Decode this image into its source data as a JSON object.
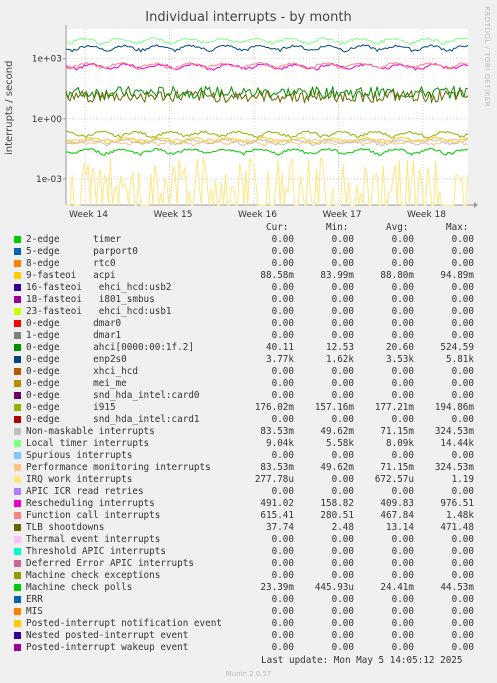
{
  "title": "Individual interrupts - by month",
  "side_label": "RRDTOOL / TOBI OETIKER",
  "footer": {
    "last_update": "Last update: Mon May  5 14:05:12 2025",
    "munin": "Munin 2.0.57"
  },
  "legend_headers": {
    "cur": "Cur:",
    "min": "Min:",
    "avg": "Avg:",
    "max": "Max:"
  },
  "chart_data": {
    "type": "line",
    "ylabel": "interrupts / second",
    "yscale": "log",
    "ylim": [
      5e-05,
      30000
    ],
    "yticks": [
      "1e+03",
      "1e+00",
      "1e-03"
    ],
    "xticks": [
      "Week 14",
      "Week 15",
      "Week 16",
      "Week 17",
      "Week 18"
    ],
    "grid": true,
    "series": [
      {
        "name": "2-edge      timer",
        "color": "#00cc00",
        "cur": "0.00",
        "min": "0.00",
        "avg": "0.00",
        "max": "0.00",
        "level": 0
      },
      {
        "name": "5-edge      parport0",
        "color": "#0066b3",
        "cur": "0.00",
        "min": "0.00",
        "avg": "0.00",
        "max": "0.00",
        "level": 0
      },
      {
        "name": "8-edge      rtc0",
        "color": "#ff8000",
        "cur": "0.00",
        "min": "0.00",
        "avg": "0.00",
        "max": "0.00",
        "level": 0
      },
      {
        "name": "9-fasteoi   acpi",
        "color": "#ffcc00",
        "cur": "88.58m",
        "min": "83.99m",
        "avg": "88.80m",
        "max": "94.89m",
        "level": 0.0888
      },
      {
        "name": "16-fasteoi   ehci_hcd:usb2",
        "color": "#330099",
        "cur": "0.00",
        "min": "0.00",
        "avg": "0.00",
        "max": "0.00",
        "level": 0
      },
      {
        "name": "18-fasteoi   i801_smbus",
        "color": "#990099",
        "cur": "0.00",
        "min": "0.00",
        "avg": "0.00",
        "max": "0.00",
        "level": 0
      },
      {
        "name": "23-fasteoi   ehci_hcd:usb1",
        "color": "#ccff00",
        "cur": "0.00",
        "min": "0.00",
        "avg": "0.00",
        "max": "0.00",
        "level": 0
      },
      {
        "name": "0-edge      dmar0",
        "color": "#ff0000",
        "cur": "0.00",
        "min": "0.00",
        "avg": "0.00",
        "max": "0.00",
        "level": 0
      },
      {
        "name": "1-edge      dmar1",
        "color": "#808080",
        "cur": "0.00",
        "min": "0.00",
        "avg": "0.00",
        "max": "0.00",
        "level": 0
      },
      {
        "name": "0-edge      ahci[0000:00:1f.2]",
        "color": "#008f00",
        "cur": "40.11",
        "min": "12.53",
        "avg": "20.60",
        "max": "524.59",
        "level": 20.6
      },
      {
        "name": "0-edge      enp2s0",
        "color": "#00487d",
        "cur": "3.77k",
        "min": "1.62k",
        "avg": "3.53k",
        "max": "5.81k",
        "level": 3530
      },
      {
        "name": "0-edge      xhci_hcd",
        "color": "#b35a00",
        "cur": "0.00",
        "min": "0.00",
        "avg": "0.00",
        "max": "0.00",
        "level": 0
      },
      {
        "name": "0-edge      mei_me",
        "color": "#b38f00",
        "cur": "0.00",
        "min": "0.00",
        "avg": "0.00",
        "max": "0.00",
        "level": 0
      },
      {
        "name": "0-edge      snd_hda_intel:card0",
        "color": "#6b006b",
        "cur": "0.00",
        "min": "0.00",
        "avg": "0.00",
        "max": "0.00",
        "level": 0
      },
      {
        "name": "0-edge      i915",
        "color": "#8fb300",
        "cur": "176.02m",
        "min": "157.16m",
        "avg": "177.21m",
        "max": "194.86m",
        "level": 0.177
      },
      {
        "name": "0-edge      snd_hda_intel:card1",
        "color": "#b30000",
        "cur": "0.00",
        "min": "0.00",
        "avg": "0.00",
        "max": "0.00",
        "level": 0
      },
      {
        "name": "Non-maskable interrupts",
        "color": "#bebebe",
        "cur": "83.53m",
        "min": "49.62m",
        "avg": "71.15m",
        "max": "324.53m",
        "level": 0.0712
      },
      {
        "name": "Local timer interrupts",
        "color": "#80ff80",
        "cur": "9.04k",
        "min": "5.58k",
        "avg": "8.09k",
        "max": "14.44k",
        "level": 8090
      },
      {
        "name": "Spurious interrupts",
        "color": "#80c9ff",
        "cur": "0.00",
        "min": "0.00",
        "avg": "0.00",
        "max": "0.00",
        "level": 0
      },
      {
        "name": "Performance monitoring interrupts",
        "color": "#ffc080",
        "cur": "83.53m",
        "min": "49.62m",
        "avg": "71.15m",
        "max": "324.53m",
        "level": 0.0712
      },
      {
        "name": "IRQ work interrupts",
        "color": "#ffe680",
        "cur": "277.78u",
        "min": "0.00",
        "avg": "672.57u",
        "max": "1.19",
        "level": 0.00067
      },
      {
        "name": "APIC ICR read retries",
        "color": "#aa80ff",
        "cur": "0.00",
        "min": "0.00",
        "avg": "0.00",
        "max": "0.00",
        "level": 0
      },
      {
        "name": "Rescheduling interrupts",
        "color": "#ee00cc",
        "cur": "491.02",
        "min": "158.82",
        "avg": "409.83",
        "max": "976.51",
        "level": 410
      },
      {
        "name": "Function call interrupts",
        "color": "#ff8080",
        "cur": "615.41",
        "min": "280.51",
        "avg": "467.84",
        "max": "1.48k",
        "level": 468
      },
      {
        "name": "TLB shootdowns",
        "color": "#666600",
        "cur": "37.74",
        "min": "2.48",
        "avg": "13.14",
        "max": "471.48",
        "level": 13.1
      },
      {
        "name": "Thermal event interrupts",
        "color": "#ffbfff",
        "cur": "0.00",
        "min": "0.00",
        "avg": "0.00",
        "max": "0.00",
        "level": 0
      },
      {
        "name": "Threshold APIC interrupts",
        "color": "#00ffcc",
        "cur": "0.00",
        "min": "0.00",
        "avg": "0.00",
        "max": "0.00",
        "level": 0
      },
      {
        "name": "Deferred Error APIC interrupts",
        "color": "#cc6699",
        "cur": "0.00",
        "min": "0.00",
        "avg": "0.00",
        "max": "0.00",
        "level": 0
      },
      {
        "name": "Machine check exceptions",
        "color": "#999900",
        "cur": "0.00",
        "min": "0.00",
        "avg": "0.00",
        "max": "0.00",
        "level": 0
      },
      {
        "name": "Machine check polls",
        "color": "#00cc00",
        "cur": "23.39m",
        "min": "445.93u",
        "avg": "24.41m",
        "max": "44.53m",
        "level": 0.0244
      },
      {
        "name": "ERR",
        "color": "#0066b3",
        "cur": "0.00",
        "min": "0.00",
        "avg": "0.00",
        "max": "0.00",
        "level": 0
      },
      {
        "name": "MIS",
        "color": "#ff8000",
        "cur": "0.00",
        "min": "0.00",
        "avg": "0.00",
        "max": "0.00",
        "level": 0
      },
      {
        "name": "Posted-interrupt notification event",
        "color": "#ffcc00",
        "cur": "0.00",
        "min": "0.00",
        "avg": "0.00",
        "max": "0.00",
        "level": 0
      },
      {
        "name": "Nested posted-interrupt event",
        "color": "#330099",
        "cur": "0.00",
        "min": "0.00",
        "avg": "0.00",
        "max": "0.00",
        "level": 0
      },
      {
        "name": "Posted-interrupt wakeup event",
        "color": "#990099",
        "cur": "0.00",
        "min": "0.00",
        "avg": "0.00",
        "max": "0.00",
        "level": 0
      }
    ]
  }
}
